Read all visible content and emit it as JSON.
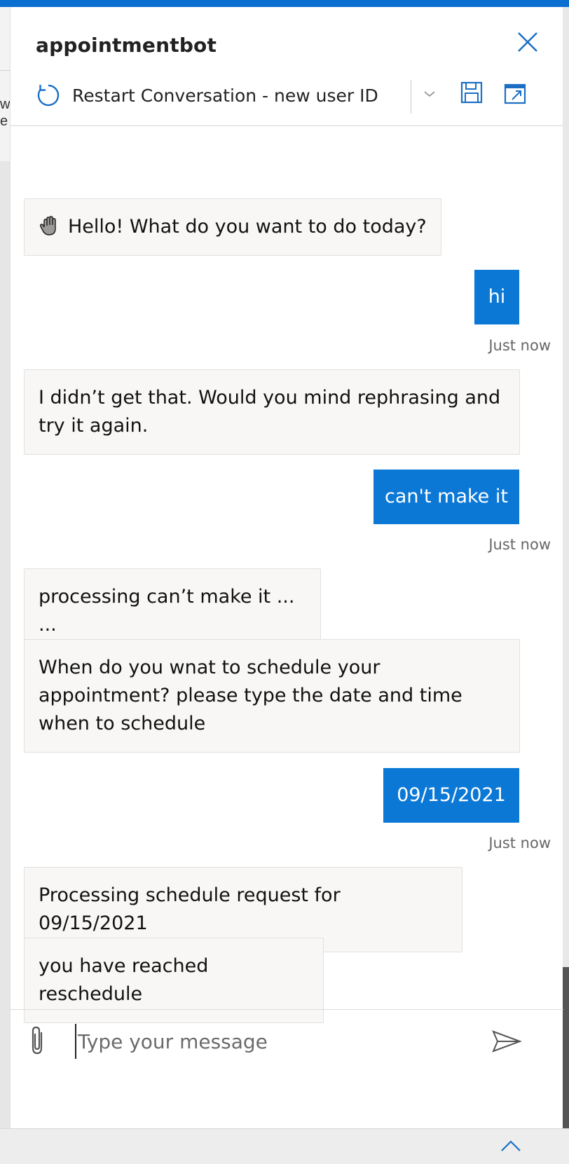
{
  "window": {
    "title": "appointmentbot",
    "accent_color": "#0b6fd1"
  },
  "background_page": {
    "fragment_line1": "w",
    "fragment_line2": "e"
  },
  "toolbar": {
    "restart_label": "Restart Conversation - new user ID",
    "icons": [
      "refresh-icon",
      "chevron-down-icon",
      "save-icon",
      "open-external-icon",
      "close-icon"
    ]
  },
  "transcript": {
    "bot_bubble_color": "#f8f7f6",
    "user_bubble_color": "#0b78d6",
    "messages": [
      {
        "from": "bot",
        "icon": "waving-hand-icon",
        "text": "Hello! What do you want to do today?"
      },
      {
        "from": "user",
        "text": "hi",
        "timestamp": "Just now"
      },
      {
        "from": "bot",
        "text_line1": "I didn’t get that. Would you mind rephrasing and",
        "text_line2": "try it again."
      },
      {
        "from": "user",
        "text": "can't make it",
        "timestamp": "Just now"
      },
      {
        "from": "bot",
        "text": "processing can’t make it ... ..."
      },
      {
        "from": "bot",
        "text_line1": "When do you wnat to schedule your",
        "text_line2": "appointment? please type the date and time",
        "text_line3": "when to schedule"
      },
      {
        "from": "user",
        "text": "09/15/2021",
        "timestamp": "Just now"
      },
      {
        "from": "bot",
        "text": "Processing schedule request for 09/15/2021"
      },
      {
        "from": "bot",
        "text": "you have reached reschedule"
      }
    ]
  },
  "composer": {
    "placeholder": "Type your message",
    "value": "",
    "icons": [
      "paperclip-icon",
      "send-icon"
    ]
  },
  "footer": {
    "icons": [
      "chevron-up-icon"
    ]
  }
}
